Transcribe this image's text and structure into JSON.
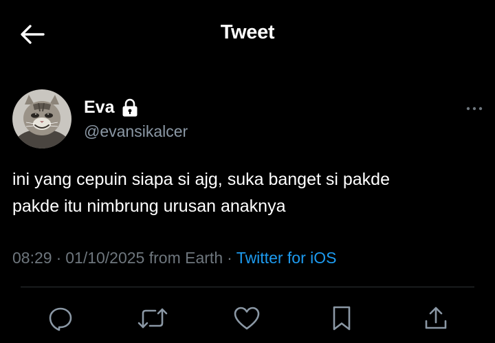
{
  "header": {
    "title": "Tweet",
    "back_icon": "arrow-left-icon"
  },
  "author": {
    "display_name": "Eva",
    "handle": "@evansikalcer",
    "protected": true,
    "avatar": "smiling-cat-avatar"
  },
  "tweet": {
    "text_line1": "ini yang cepuin siapa si ajg, suka banget si pakde",
    "text_line2": "pakde itu nimbrung urusan anaknya"
  },
  "meta": {
    "time": "08:29",
    "date": "01/10/2025",
    "location": "from Earth",
    "separator": "·",
    "source": "Twitter for iOS"
  },
  "actions": [
    {
      "name": "reply",
      "icon": "reply-icon"
    },
    {
      "name": "retweet",
      "icon": "retweet-icon"
    },
    {
      "name": "like",
      "icon": "heart-icon"
    },
    {
      "name": "bookmark",
      "icon": "bookmark-icon"
    },
    {
      "name": "share",
      "icon": "share-icon"
    }
  ],
  "colors": {
    "background": "#000000",
    "text": "#ffffff",
    "secondary": "#8b98a5",
    "link": "#1d9bf0",
    "divider": "#2f3336"
  }
}
